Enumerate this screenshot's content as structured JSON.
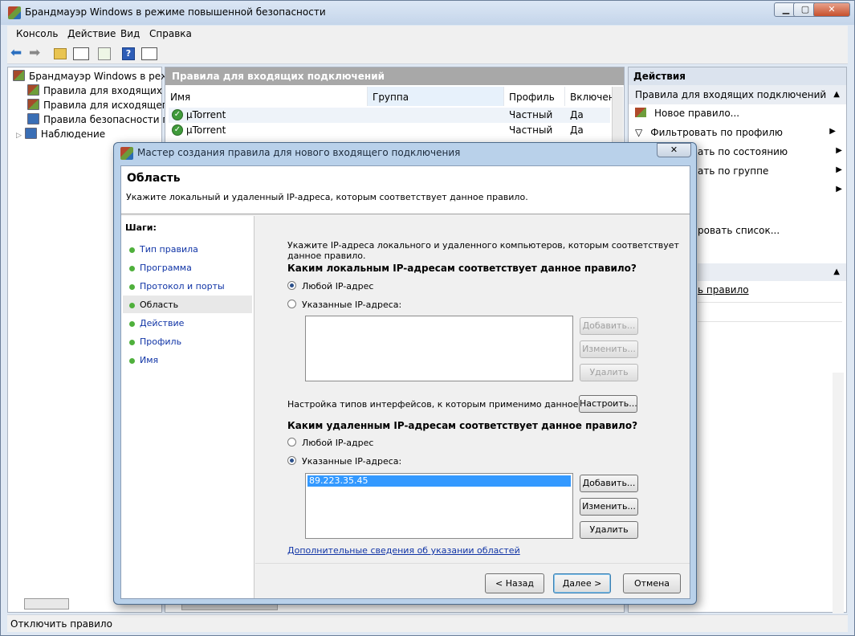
{
  "main": {
    "title": "Брандмауэр Windows в режиме повышенной безопасности",
    "menu": [
      "Консоль",
      "Действие",
      "Вид",
      "Справка"
    ],
    "caption": {
      "minimize": "▁",
      "maximize": "▢",
      "close": "✕"
    }
  },
  "tree": {
    "items": [
      "Брандмауэр Windows в режим",
      "Правила для входящих по,",
      "Правила для исходящего п",
      "Правила безопасности по,",
      "Наблюдение"
    ]
  },
  "center": {
    "header": "Правила для входящих подключений",
    "columns": [
      "Имя",
      "Группа",
      "Профиль",
      "Включен"
    ],
    "rows": [
      {
        "name": "µTorrent",
        "group": "",
        "profile": "Частный",
        "enabled": "Да"
      },
      {
        "name": "µTorrent",
        "group": "",
        "profile": "Частный",
        "enabled": "Да"
      }
    ]
  },
  "actions": {
    "header": "Действия",
    "subheader": "Правила для входящих подключений",
    "items": [
      "Новое правило...",
      "Фильтровать по профилю",
      "ать по состоянию",
      "ать по группе",
      "",
      "ровать список...",
      "ь правило"
    ]
  },
  "status": "Отключить правило",
  "dialog": {
    "title": "Мастер создания правила для нового входящего подключения",
    "close": "✕",
    "heading": "Область",
    "description": "Укажите локальный и удаленный IP-адреса, которым соответствует данное правило.",
    "steps_header": "Шаги:",
    "steps": [
      "Тип правила",
      "Программа",
      "Протокол и порты",
      "Область",
      "Действие",
      "Профиль",
      "Имя"
    ],
    "intro_line1": "Укажите IP-адреса локального и удаленного компьютеров, которым соответствует",
    "intro_line2": "данное правило.",
    "local_question": "Каким локальным IP-адресам соответствует данное правило?",
    "local_any": "Любой IP-адрес",
    "local_specific": "Указанные IP-адреса:",
    "interface_text": "Настройка типов интерфейсов, к которым применимо данное",
    "configure": "Настроить...",
    "remote_question": "Каким удаленным IP-адресам соответствует данное правило?",
    "remote_any": "Любой IP-адрес",
    "remote_specific": "Указанные IP-адреса:",
    "remote_list": [
      "89.223.35.45"
    ],
    "add": "Добавить...",
    "edit": "Изменить...",
    "delete": "Удалить",
    "learn_more": "Дополнительные сведения об указании областей",
    "back": "< Назад",
    "next": "Далее >",
    "cancel": "Отмена"
  }
}
